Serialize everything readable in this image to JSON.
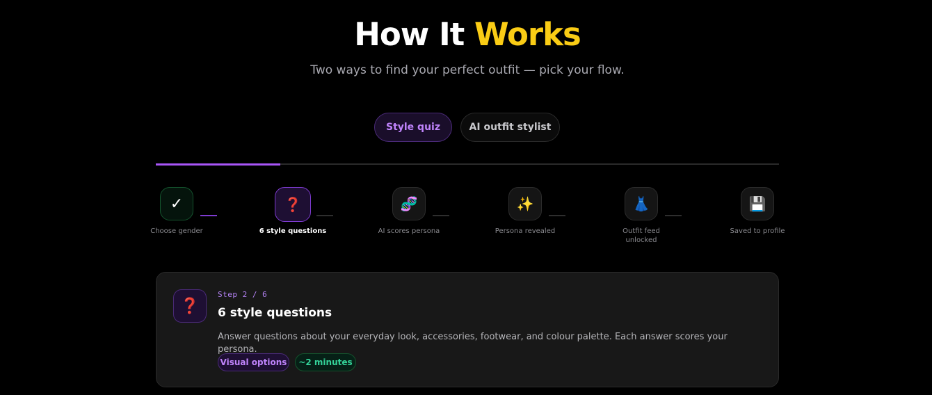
{
  "header": {
    "title_part1": "How It",
    "title_part2": "Works",
    "subtitle": "Two ways to find your perfect outfit — pick your flow."
  },
  "tabs": [
    {
      "label": "Style quiz",
      "active": true
    },
    {
      "label": "AI outfit stylist",
      "active": false
    }
  ],
  "progress": {
    "current_step": 2,
    "total_steps": 6,
    "fraction": 0.2
  },
  "steps": [
    {
      "icon": "✓",
      "icon_name": "check-icon",
      "label": "Choose gender",
      "state": "done"
    },
    {
      "icon": "❓",
      "icon_name": "question-icon",
      "label": "6 style questions",
      "state": "current"
    },
    {
      "icon": "🧬",
      "icon_name": "dna-icon",
      "label": "AI scores persona",
      "state": "upcoming"
    },
    {
      "icon": "✨",
      "icon_name": "sparkles-icon",
      "label": "Persona revealed",
      "state": "upcoming"
    },
    {
      "icon": "👗",
      "icon_name": "dress-icon",
      "label": "Outfit feed unlocked",
      "state": "upcoming"
    },
    {
      "icon": "💾",
      "icon_name": "floppy-disk-icon",
      "label": "Saved to profile",
      "state": "upcoming"
    }
  ],
  "detail": {
    "icon": "❓",
    "step_text": "Step 2 / 6",
    "title": "6 style questions",
    "description": "Answer questions about your everyday look, accessories, footwear, and colour palette. Each answer scores your persona.",
    "chips": [
      "Visual options",
      "~2 minutes"
    ]
  },
  "colors": {
    "accent_purple": "#a855f7",
    "accent_yellow": "#facc15",
    "accent_green": "#34d399",
    "background": "#000000"
  }
}
